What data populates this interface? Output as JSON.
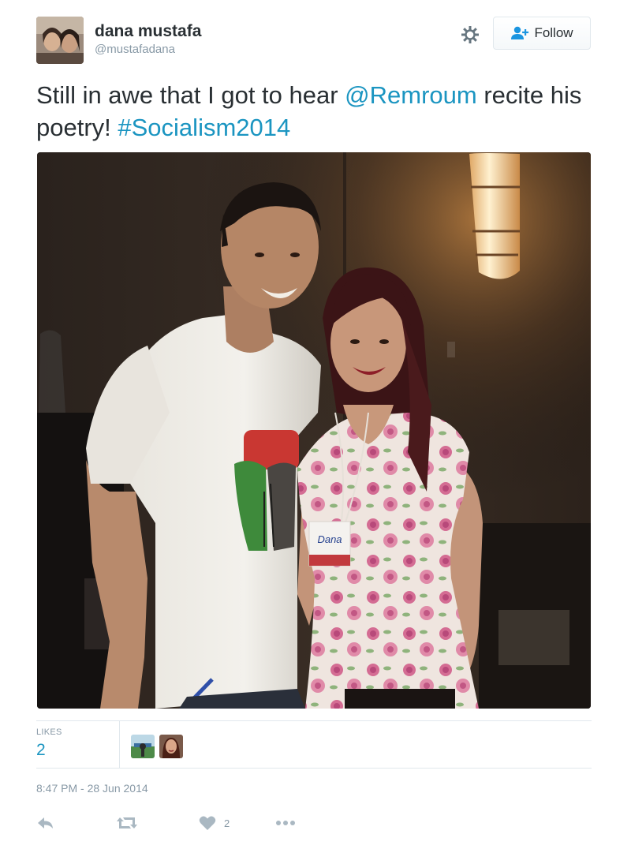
{
  "user": {
    "display_name": "dana mustafa",
    "handle": "@mustafadana"
  },
  "header": {
    "follow_label": "Follow",
    "settings_icon": "gear-icon",
    "follow_icon": "add-user-icon"
  },
  "tweet": {
    "text_parts": {
      "part1": "Still in awe that I got to hear ",
      "mention": "@Remroum",
      "part2": " recite his poetry! ",
      "hashtag": "#Socialism2014"
    },
    "link_color": "#1b95c1"
  },
  "photo": {
    "badge_name": "Dana"
  },
  "stats": {
    "likes_label": "LIKES",
    "likes_count": "2"
  },
  "timestamp": "8:47 PM - 28 Jun 2014",
  "actions": {
    "reply_icon": "reply-icon",
    "retweet_icon": "retweet-icon",
    "like_icon": "heart-icon",
    "like_count": "2",
    "more_icon": "more-icon"
  }
}
